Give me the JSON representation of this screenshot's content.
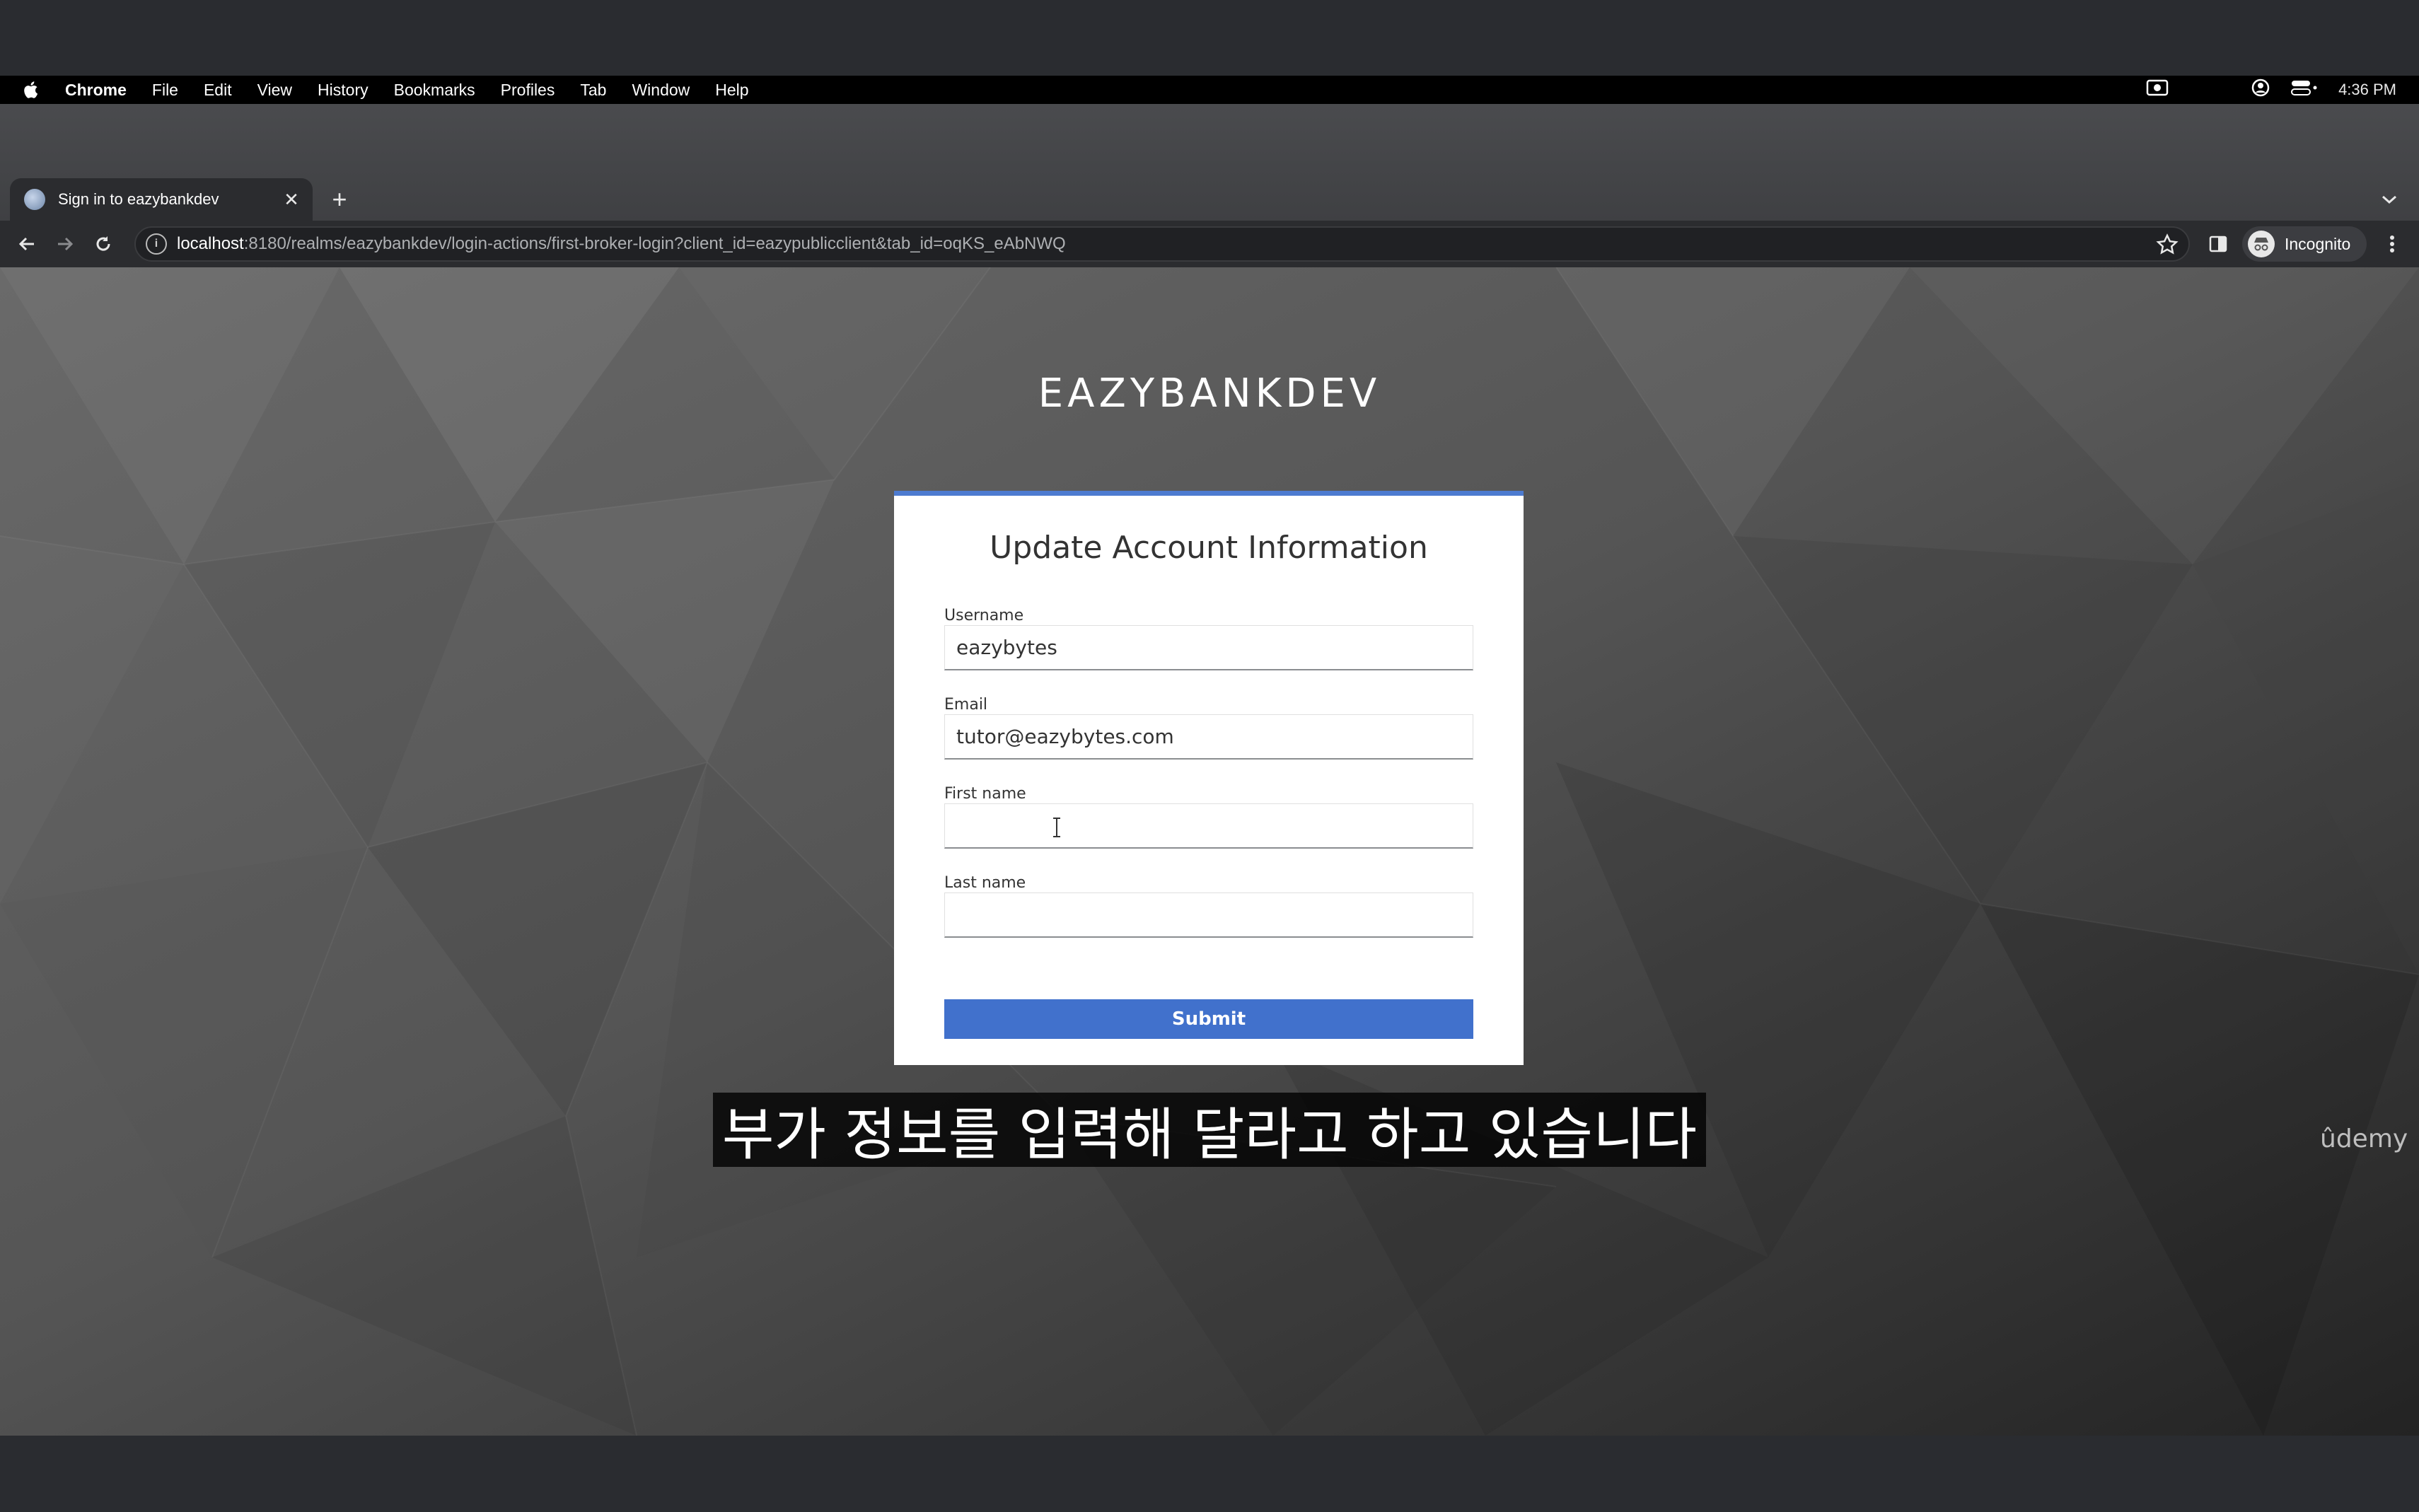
{
  "menubar": {
    "app": "Chrome",
    "items": [
      "File",
      "Edit",
      "View",
      "History",
      "Bookmarks",
      "Profiles",
      "Tab",
      "Window",
      "Help"
    ],
    "clock": "4:36 PM"
  },
  "browser": {
    "tab_title": "Sign in to eazybankdev",
    "url_host": "localhost",
    "url_rest": ":8180/realms/eazybankdev/login-actions/first-broker-login?client_id=eazypublicclient&tab_id=oqKS_eAbNWQ",
    "incognito_label": "Incognito"
  },
  "page": {
    "realm_title": "EAZYBANKDEV",
    "card_title": "Update Account Information",
    "fields": [
      {
        "label": "Username",
        "value": "eazybytes"
      },
      {
        "label": "Email",
        "value": "tutor@eazybytes.com"
      },
      {
        "label": "First name",
        "value": ""
      },
      {
        "label": "Last name",
        "value": ""
      }
    ],
    "submit_label": "Submit"
  },
  "overlay": {
    "subtitle": "부가 정보를 입력해 달라고 하고 있습니다",
    "watermark": "ûdemy"
  },
  "colors": {
    "accent": "#4171cc",
    "card_border": "#4d7bd0"
  }
}
